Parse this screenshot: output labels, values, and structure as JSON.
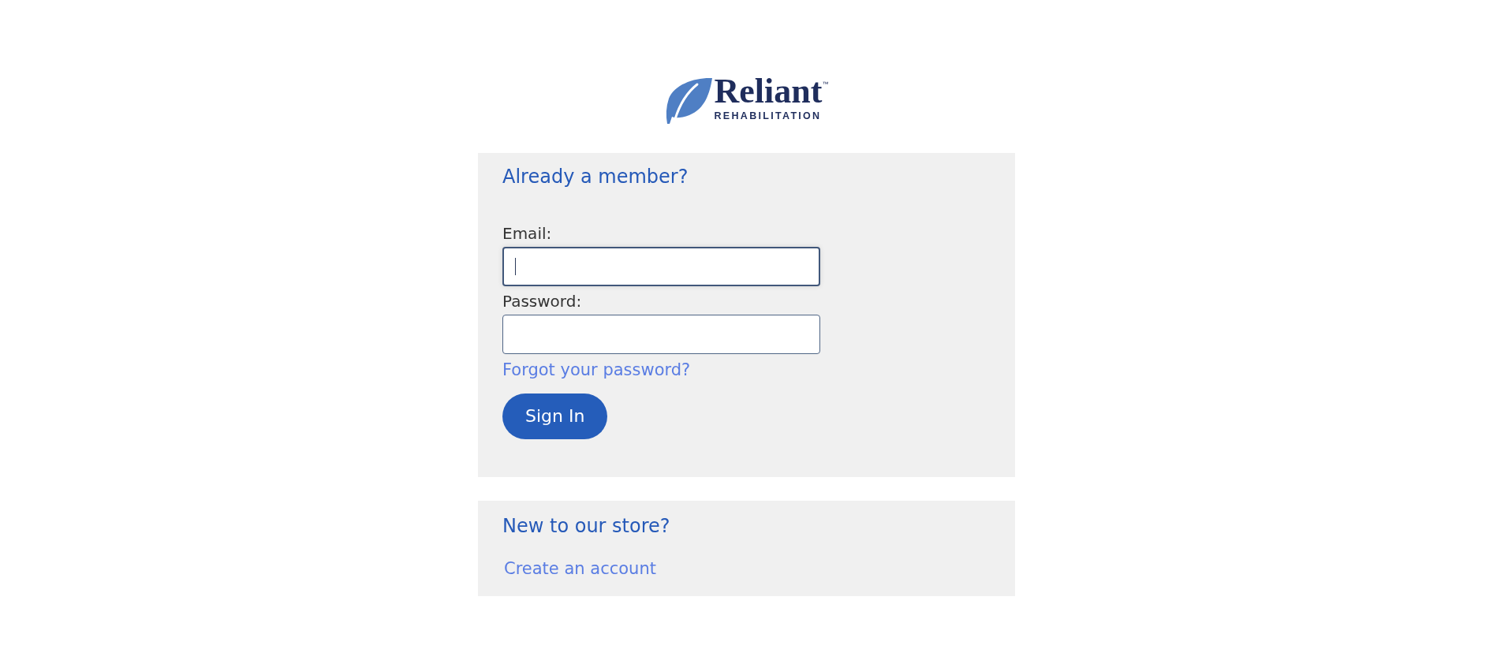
{
  "logo": {
    "name": "Reliant",
    "trademark": "™",
    "tagline": "REHABILITATION"
  },
  "login": {
    "title": "Already a member?",
    "fields": [
      {
        "label": "Email:",
        "focused": true
      },
      {
        "label": "Password:",
        "focused": false
      }
    ],
    "forgot_link": "Forgot your password?",
    "submit": "Sign In"
  },
  "register": {
    "title": "New to our store?",
    "link": "Create an account"
  }
}
